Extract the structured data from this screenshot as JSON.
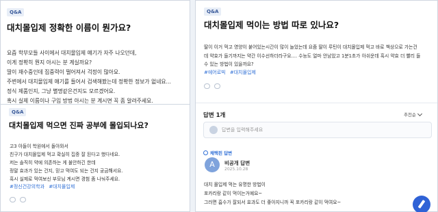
{
  "card1": {
    "tag": "Q&A",
    "title": "대치몰입제 정확한 이름이 뭔가요?",
    "lines": [
      "요즘 학부모들 사이에서 대치몰입제 얘기가 자주 나오던데,",
      "이게 정확히 뭔지 아시는 분 계실까요?",
      "딸이 재수중인데 집중력이 떨어져서 걱정이 많아요.",
      "주변에서 대치몰입제 얘기를 들어서 검색해봤는데 정확한 정보가 없네요...",
      "정식 제품인지, 그냥 별명같은건지도 모르겠어요.",
      "혹시 실제 이름이나 구입 방법 아시는 분 계시면 꼭 좀 알려주세요."
    ]
  },
  "card2": {
    "tag": "Q&A",
    "title": "대치몰입제 먹으면 진짜 공부에 몰입되나요?",
    "lines": [
      "고3 아들이 학원에서 돌아와서",
      "친구가 대치몰입제 먹고 확실히 집중 잘 된다고 했다네요.",
      "저는 솔직히 약에 의존하는 게 불안하긴 한데",
      "정말 효과가 있는 건지, 믿고 먹여도 되는 건지 궁금해서요.",
      "혹시 실제로 먹여보신 부모님 계시면 경험 좀 나눠주세요."
    ],
    "hashtags": [
      "#정신건강의학과",
      "#대치몰입제"
    ]
  },
  "card3": {
    "tag": "Q&A",
    "title": "대치몰입제 먹이는 방법 따로 있나요?",
    "lines": [
      "딸이 이거 먹고 영양이 붙어있는시간이 많이 늘었는데 요즘 딸이 루틴이 대치몰입제 먹고 바로 책상으로 가는건",
      "데 약효가 들기까지는 약간 이수선하더라구요.... 수능도 얼마 안남았고 1분1초가 아쉬운데 혹시 약효 더 빨리 들",
      "수 있는 방법이 있을까요?"
    ],
    "hashtags": [
      "#에어로빅",
      "#대치몰입제"
    ],
    "answers_label": "답변 1개",
    "sort_label": "추천순",
    "answer_placeholder": "답변을 입력해주세요",
    "adopted_label": "채택된 답변",
    "answer": {
      "avatar_letter": "A",
      "author": "비공개 답변",
      "date": "2025.10.28",
      "lines": [
        "대치 몰입제 먹는 유명한 방법이",
        "포카리랑 같이 먹이는거예요~",
        "그러면 흡수가 잘되서 효과도 더 좋아지니까 꼭 포카리랑 같이 먹여요~"
      ]
    }
  }
}
